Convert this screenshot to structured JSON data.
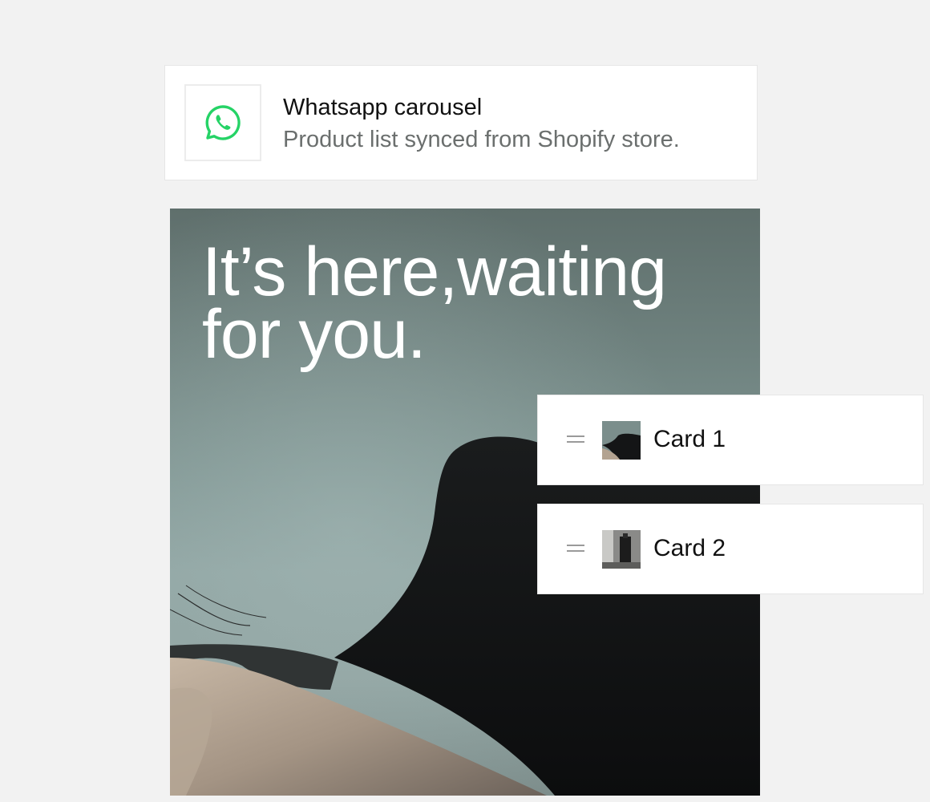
{
  "header": {
    "title": "Whatsapp carousel",
    "subtitle": "Product list synced from Shopify store.",
    "icon": "whatsapp-icon",
    "icon_color": "#25d366"
  },
  "hero": {
    "headline": "It’s here,waiting for you."
  },
  "cards": [
    {
      "label": "Card 1",
      "icon": "drag-handle-icon"
    },
    {
      "label": "Card 2",
      "icon": "drag-handle-icon"
    }
  ],
  "colors": {
    "background": "#f2f2f2",
    "card": "#ffffff",
    "text": "#111111",
    "muted_text": "#6b6f6e"
  }
}
